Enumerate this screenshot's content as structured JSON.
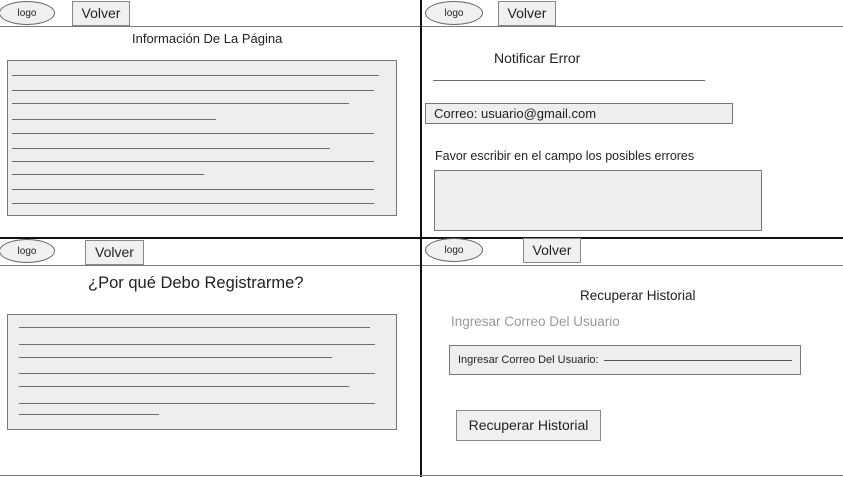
{
  "panel1": {
    "logo": "logo",
    "back": "Volver",
    "title": "Información De La Página"
  },
  "panel2": {
    "logo": "logo",
    "back": "Volver",
    "title": "Notificar Error",
    "email": "Correo:  usuario@gmail.com",
    "instructions": "Favor escribir en el campo los posibles errores"
  },
  "panel3": {
    "logo": "logo",
    "back": "Volver",
    "title": "¿Por qué Debo Registrarme?"
  },
  "panel4": {
    "logo": "logo",
    "back": "Volver",
    "title": "Recuperar Historial",
    "email_placeholder": "Ingresar Correo Del Usuario",
    "email_field_label": "Ingresar Correo Del Usuario:",
    "submit": "Recuperar Historial"
  }
}
